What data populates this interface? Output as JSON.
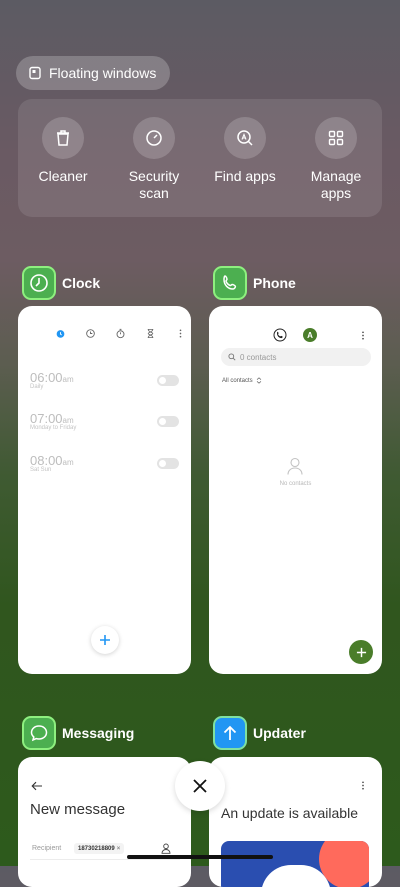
{
  "floating_windows": {
    "label": "Floating windows"
  },
  "quick_actions": [
    {
      "label": "Cleaner",
      "icon": "trash-icon"
    },
    {
      "label": "Security\nscan",
      "icon": "security-icon"
    },
    {
      "label": "Find apps",
      "icon": "find-apps-icon"
    },
    {
      "label": "Manage\napps",
      "icon": "grid-icon"
    }
  ],
  "apps": {
    "clock": {
      "name": "Clock",
      "alarms": [
        {
          "time": "06:00",
          "period": "am",
          "label": "Daily"
        },
        {
          "time": "07:00",
          "period": "am",
          "label": "Monday to Friday"
        },
        {
          "time": "08:00",
          "period": "am",
          "label": "Sat Sun"
        }
      ]
    },
    "phone": {
      "name": "Phone",
      "search_placeholder": "0 contacts",
      "filter": "All contacts",
      "empty": "No contacts",
      "avatar_letter": "A"
    },
    "messaging": {
      "name": "Messaging",
      "title": "New message",
      "recipient_label": "Recipient",
      "recipient_value": "18730218809"
    },
    "updater": {
      "name": "Updater",
      "title": "An update is available"
    }
  },
  "colors": {
    "accent_blue": "#2196f3",
    "phone_green": "#4a7d2a",
    "app_icon_green": "#4caf50"
  }
}
